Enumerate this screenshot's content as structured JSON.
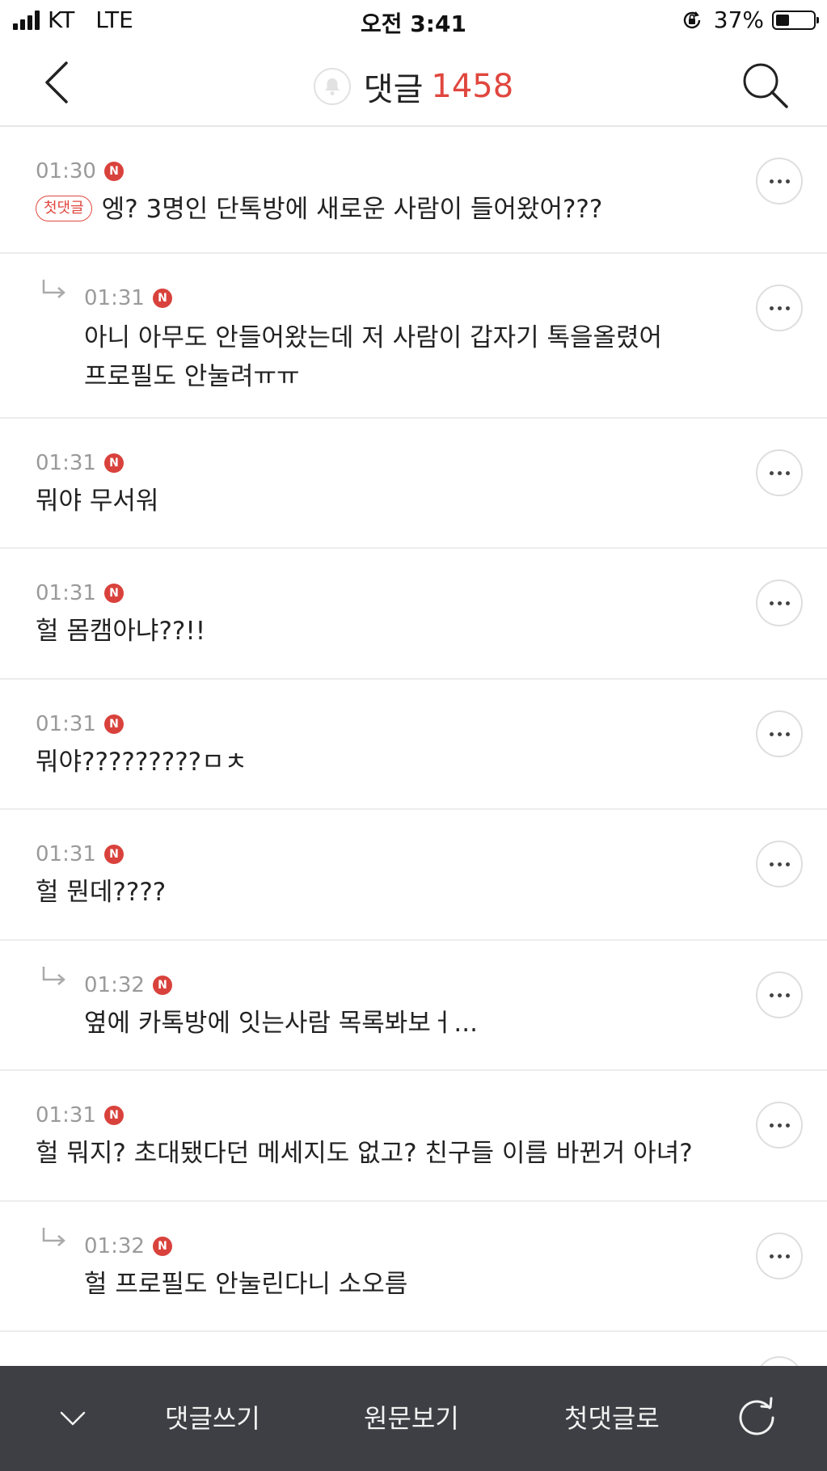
{
  "status_bar": {
    "carrier": "KT",
    "network": "LTE",
    "time": "오전 3:41",
    "battery": "37%",
    "battery_level": 0.37
  },
  "header": {
    "title": "댓글",
    "count": "1458"
  },
  "comments": [
    {
      "time": "01:30",
      "badge": "N",
      "tag": "첫댓글",
      "lines": [
        "엥? 3명인 단톡방에 새로운 사람이 들어왔어???"
      ],
      "reply": false
    },
    {
      "time": "01:31",
      "badge": "N",
      "lines": [
        "아니 아무도 안들어왔는데 저 사람이 갑자기 톡을올렸어",
        "프로필도 안눌려ㅠㅠ"
      ],
      "reply": true
    },
    {
      "time": "01:31",
      "badge": "N",
      "lines": [
        "뭐야 무서워"
      ],
      "reply": false
    },
    {
      "time": "01:31",
      "badge": "N",
      "lines": [
        "헐 몸캠아냐??!!"
      ],
      "reply": false
    },
    {
      "time": "01:31",
      "badge": "N",
      "lines": [
        "뭐야?????????ㅁㅊ"
      ],
      "reply": false
    },
    {
      "time": "01:31",
      "badge": "N",
      "lines": [
        "헐 뭔데????"
      ],
      "reply": false
    },
    {
      "time": "01:32",
      "badge": "N",
      "lines": [
        "옆에 카톡방에 잇는사람 목록봐보ㅓ..."
      ],
      "reply": true
    },
    {
      "time": "01:31",
      "badge": "N",
      "lines": [
        "헐 뭐지? 초대됐다던 메세지도 없고? 친구들 이름 바뀐거 아녀?"
      ],
      "reply": false
    },
    {
      "time": "01:32",
      "badge": "N",
      "lines": [
        "헐 프로필도 안눌린다니 소오름"
      ],
      "reply": true
    }
  ],
  "bottom_bar": {
    "write": "댓글쓰기",
    "original": "원문보기",
    "first": "첫댓글로"
  },
  "colors": {
    "accent": "#e0473f",
    "bottom_bar": "#3d3f44"
  }
}
